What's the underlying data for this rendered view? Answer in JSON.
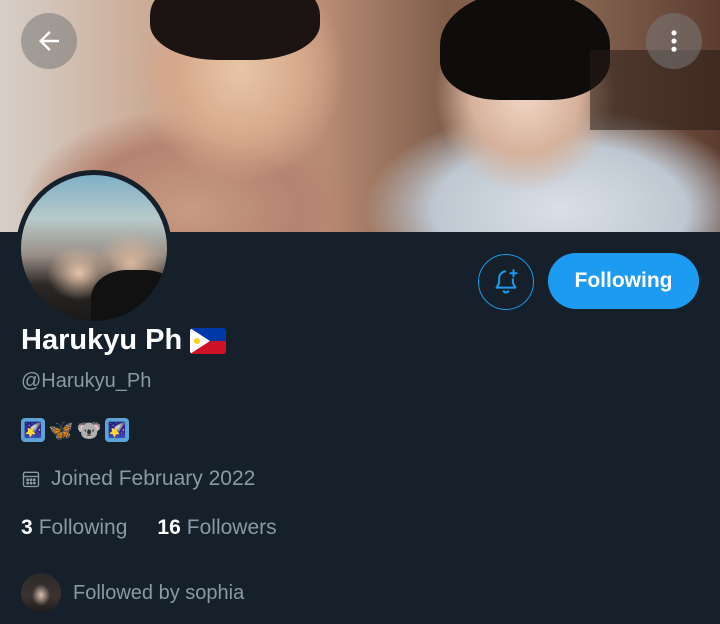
{
  "header": {
    "back_icon": "arrow-left-icon",
    "more_icon": "more-vertical-icon"
  },
  "actions": {
    "notify_icon": "bell-plus-icon",
    "following_label": "Following"
  },
  "profile": {
    "display_name": "Harukyu Ph",
    "name_emoji": "philippines-flag-icon",
    "handle": "@Harukyu_Ph",
    "bio_emojis": [
      "🌠",
      "🦋",
      "🐨",
      "🌠"
    ],
    "joined_icon": "calendar-icon",
    "joined": "Joined February 2022",
    "following_count": "3",
    "following_label": "Following",
    "followers_count": "16",
    "followers_label": "Followers",
    "followed_by": "Followed by sophia"
  },
  "colors": {
    "background": "#15202b",
    "accent": "#1d9bf0",
    "secondary_text": "#8b98a5",
    "primary_text": "#ffffff"
  }
}
